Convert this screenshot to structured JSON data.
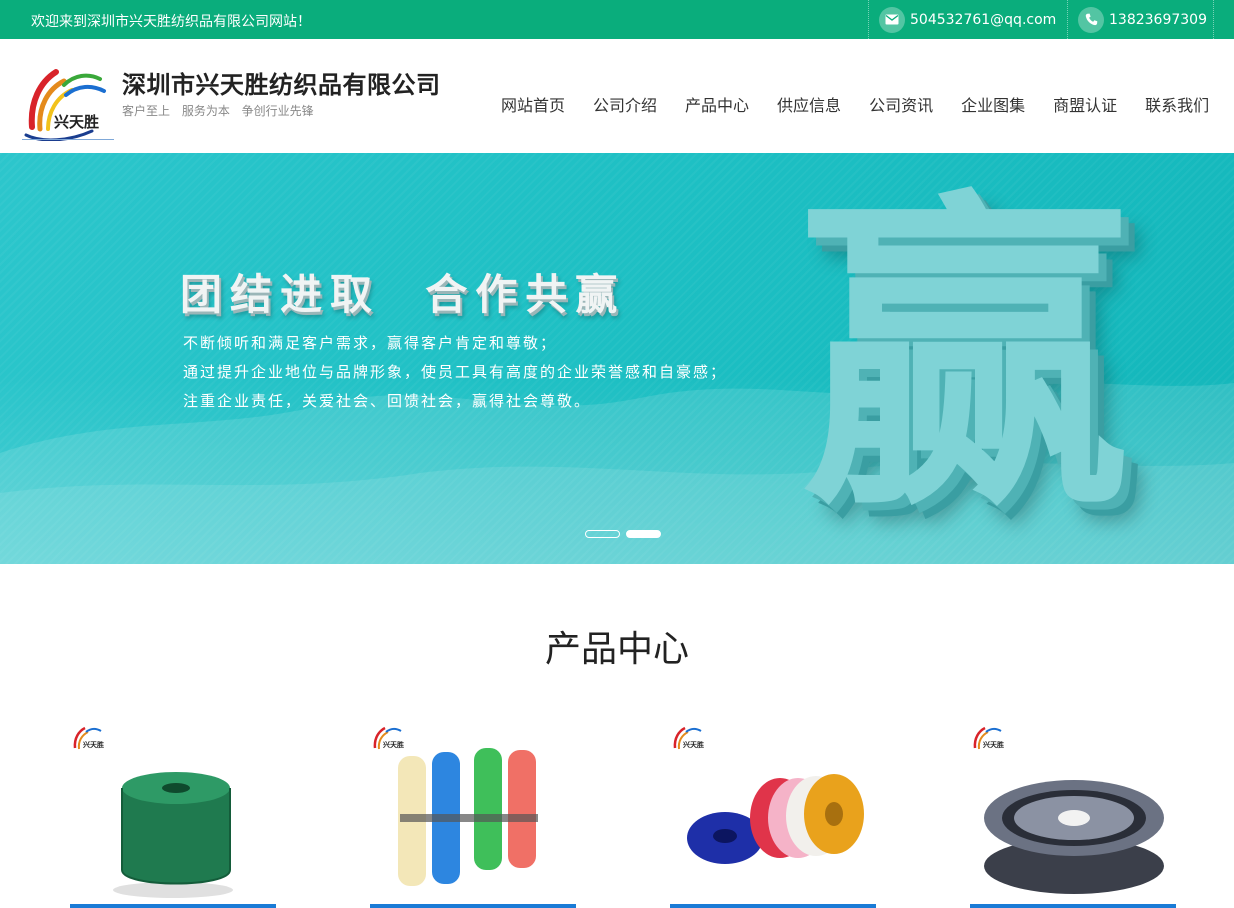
{
  "topbar": {
    "welcome": "欢迎来到深圳市兴天胜纺织品有限公司网站！",
    "email": "504532761@qq.com",
    "phone": "13823697309"
  },
  "header": {
    "logo_text": "兴天胜",
    "company_name": "深圳市兴天胜纺织品有限公司",
    "slogan": "客户至上 服务为本 争创行业先锋"
  },
  "nav": {
    "items": [
      "网站首页",
      "公司介绍",
      "产品中心",
      "供应信息",
      "公司资讯",
      "企业图集",
      "商盟认证",
      "联系我们"
    ]
  },
  "banner": {
    "headline": "团结进取  合作共赢",
    "lines": [
      "不断倾听和满足客户需求，赢得客户肯定和尊敬；",
      "通过提升企业地位与品牌形象，使员工具有高度的企业荣誉感和自豪感；",
      "注重企业责任，关爱社会、回馈社会，赢得社会尊敬。"
    ],
    "big_char": "赢",
    "active_slide": 2,
    "slide_count": 2
  },
  "products": {
    "title": "产品中心",
    "watermark": "兴天胜"
  },
  "colors": {
    "topbar": "#0aad7c",
    "banner": "#1ec0c4",
    "accent_bar": "#1a7bd6"
  }
}
